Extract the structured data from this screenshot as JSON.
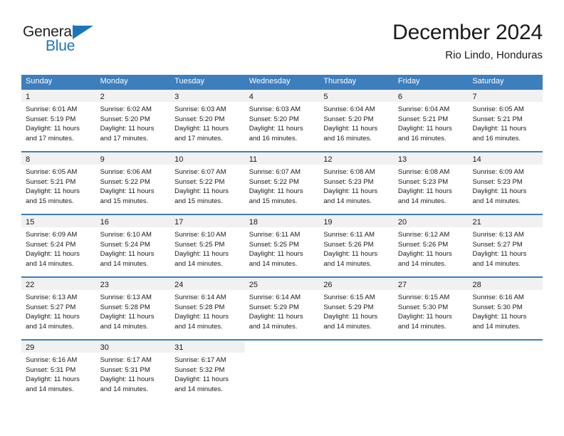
{
  "brand": {
    "name_part1": "General",
    "name_part2": "Blue",
    "triangle_icon": "triangle-icon",
    "color_dark": "#231f20",
    "color_blue": "#1b75bb"
  },
  "header": {
    "title": "December 2024",
    "subtitle": "Rio Lindo, Honduras"
  },
  "theme": {
    "header_blue": "#3d7ebd",
    "day_band_gray": "#f1f1f1",
    "text": "#1a1a1a"
  },
  "weekdays": [
    "Sunday",
    "Monday",
    "Tuesday",
    "Wednesday",
    "Thursday",
    "Friday",
    "Saturday"
  ],
  "labels": {
    "sunrise_prefix": "Sunrise:",
    "sunset_prefix": "Sunset:",
    "daylight_prefix": "Daylight:"
  },
  "weeks": [
    [
      {
        "day": "1",
        "sunrise": "Sunrise: 6:01 AM",
        "sunset": "Sunset: 5:19 PM",
        "daylight_1": "Daylight: 11 hours",
        "daylight_2": "and 17 minutes."
      },
      {
        "day": "2",
        "sunrise": "Sunrise: 6:02 AM",
        "sunset": "Sunset: 5:20 PM",
        "daylight_1": "Daylight: 11 hours",
        "daylight_2": "and 17 minutes."
      },
      {
        "day": "3",
        "sunrise": "Sunrise: 6:03 AM",
        "sunset": "Sunset: 5:20 PM",
        "daylight_1": "Daylight: 11 hours",
        "daylight_2": "and 17 minutes."
      },
      {
        "day": "4",
        "sunrise": "Sunrise: 6:03 AM",
        "sunset": "Sunset: 5:20 PM",
        "daylight_1": "Daylight: 11 hours",
        "daylight_2": "and 16 minutes."
      },
      {
        "day": "5",
        "sunrise": "Sunrise: 6:04 AM",
        "sunset": "Sunset: 5:20 PM",
        "daylight_1": "Daylight: 11 hours",
        "daylight_2": "and 16 minutes."
      },
      {
        "day": "6",
        "sunrise": "Sunrise: 6:04 AM",
        "sunset": "Sunset: 5:21 PM",
        "daylight_1": "Daylight: 11 hours",
        "daylight_2": "and 16 minutes."
      },
      {
        "day": "7",
        "sunrise": "Sunrise: 6:05 AM",
        "sunset": "Sunset: 5:21 PM",
        "daylight_1": "Daylight: 11 hours",
        "daylight_2": "and 16 minutes."
      }
    ],
    [
      {
        "day": "8",
        "sunrise": "Sunrise: 6:05 AM",
        "sunset": "Sunset: 5:21 PM",
        "daylight_1": "Daylight: 11 hours",
        "daylight_2": "and 15 minutes."
      },
      {
        "day": "9",
        "sunrise": "Sunrise: 6:06 AM",
        "sunset": "Sunset: 5:22 PM",
        "daylight_1": "Daylight: 11 hours",
        "daylight_2": "and 15 minutes."
      },
      {
        "day": "10",
        "sunrise": "Sunrise: 6:07 AM",
        "sunset": "Sunset: 5:22 PM",
        "daylight_1": "Daylight: 11 hours",
        "daylight_2": "and 15 minutes."
      },
      {
        "day": "11",
        "sunrise": "Sunrise: 6:07 AM",
        "sunset": "Sunset: 5:22 PM",
        "daylight_1": "Daylight: 11 hours",
        "daylight_2": "and 15 minutes."
      },
      {
        "day": "12",
        "sunrise": "Sunrise: 6:08 AM",
        "sunset": "Sunset: 5:23 PM",
        "daylight_1": "Daylight: 11 hours",
        "daylight_2": "and 14 minutes."
      },
      {
        "day": "13",
        "sunrise": "Sunrise: 6:08 AM",
        "sunset": "Sunset: 5:23 PM",
        "daylight_1": "Daylight: 11 hours",
        "daylight_2": "and 14 minutes."
      },
      {
        "day": "14",
        "sunrise": "Sunrise: 6:09 AM",
        "sunset": "Sunset: 5:23 PM",
        "daylight_1": "Daylight: 11 hours",
        "daylight_2": "and 14 minutes."
      }
    ],
    [
      {
        "day": "15",
        "sunrise": "Sunrise: 6:09 AM",
        "sunset": "Sunset: 5:24 PM",
        "daylight_1": "Daylight: 11 hours",
        "daylight_2": "and 14 minutes."
      },
      {
        "day": "16",
        "sunrise": "Sunrise: 6:10 AM",
        "sunset": "Sunset: 5:24 PM",
        "daylight_1": "Daylight: 11 hours",
        "daylight_2": "and 14 minutes."
      },
      {
        "day": "17",
        "sunrise": "Sunrise: 6:10 AM",
        "sunset": "Sunset: 5:25 PM",
        "daylight_1": "Daylight: 11 hours",
        "daylight_2": "and 14 minutes."
      },
      {
        "day": "18",
        "sunrise": "Sunrise: 6:11 AM",
        "sunset": "Sunset: 5:25 PM",
        "daylight_1": "Daylight: 11 hours",
        "daylight_2": "and 14 minutes."
      },
      {
        "day": "19",
        "sunrise": "Sunrise: 6:11 AM",
        "sunset": "Sunset: 5:26 PM",
        "daylight_1": "Daylight: 11 hours",
        "daylight_2": "and 14 minutes."
      },
      {
        "day": "20",
        "sunrise": "Sunrise: 6:12 AM",
        "sunset": "Sunset: 5:26 PM",
        "daylight_1": "Daylight: 11 hours",
        "daylight_2": "and 14 minutes."
      },
      {
        "day": "21",
        "sunrise": "Sunrise: 6:13 AM",
        "sunset": "Sunset: 5:27 PM",
        "daylight_1": "Daylight: 11 hours",
        "daylight_2": "and 14 minutes."
      }
    ],
    [
      {
        "day": "22",
        "sunrise": "Sunrise: 6:13 AM",
        "sunset": "Sunset: 5:27 PM",
        "daylight_1": "Daylight: 11 hours",
        "daylight_2": "and 14 minutes."
      },
      {
        "day": "23",
        "sunrise": "Sunrise: 6:13 AM",
        "sunset": "Sunset: 5:28 PM",
        "daylight_1": "Daylight: 11 hours",
        "daylight_2": "and 14 minutes."
      },
      {
        "day": "24",
        "sunrise": "Sunrise: 6:14 AM",
        "sunset": "Sunset: 5:28 PM",
        "daylight_1": "Daylight: 11 hours",
        "daylight_2": "and 14 minutes."
      },
      {
        "day": "25",
        "sunrise": "Sunrise: 6:14 AM",
        "sunset": "Sunset: 5:29 PM",
        "daylight_1": "Daylight: 11 hours",
        "daylight_2": "and 14 minutes."
      },
      {
        "day": "26",
        "sunrise": "Sunrise: 6:15 AM",
        "sunset": "Sunset: 5:29 PM",
        "daylight_1": "Daylight: 11 hours",
        "daylight_2": "and 14 minutes."
      },
      {
        "day": "27",
        "sunrise": "Sunrise: 6:15 AM",
        "sunset": "Sunset: 5:30 PM",
        "daylight_1": "Daylight: 11 hours",
        "daylight_2": "and 14 minutes."
      },
      {
        "day": "28",
        "sunrise": "Sunrise: 6:16 AM",
        "sunset": "Sunset: 5:30 PM",
        "daylight_1": "Daylight: 11 hours",
        "daylight_2": "and 14 minutes."
      }
    ],
    [
      {
        "day": "29",
        "sunrise": "Sunrise: 6:16 AM",
        "sunset": "Sunset: 5:31 PM",
        "daylight_1": "Daylight: 11 hours",
        "daylight_2": "and 14 minutes."
      },
      {
        "day": "30",
        "sunrise": "Sunrise: 6:17 AM",
        "sunset": "Sunset: 5:31 PM",
        "daylight_1": "Daylight: 11 hours",
        "daylight_2": "and 14 minutes."
      },
      {
        "day": "31",
        "sunrise": "Sunrise: 6:17 AM",
        "sunset": "Sunset: 5:32 PM",
        "daylight_1": "Daylight: 11 hours",
        "daylight_2": "and 14 minutes."
      },
      {
        "day": "",
        "sunrise": "",
        "sunset": "",
        "daylight_1": "",
        "daylight_2": ""
      },
      {
        "day": "",
        "sunrise": "",
        "sunset": "",
        "daylight_1": "",
        "daylight_2": ""
      },
      {
        "day": "",
        "sunrise": "",
        "sunset": "",
        "daylight_1": "",
        "daylight_2": ""
      },
      {
        "day": "",
        "sunrise": "",
        "sunset": "",
        "daylight_1": "",
        "daylight_2": ""
      }
    ]
  ]
}
